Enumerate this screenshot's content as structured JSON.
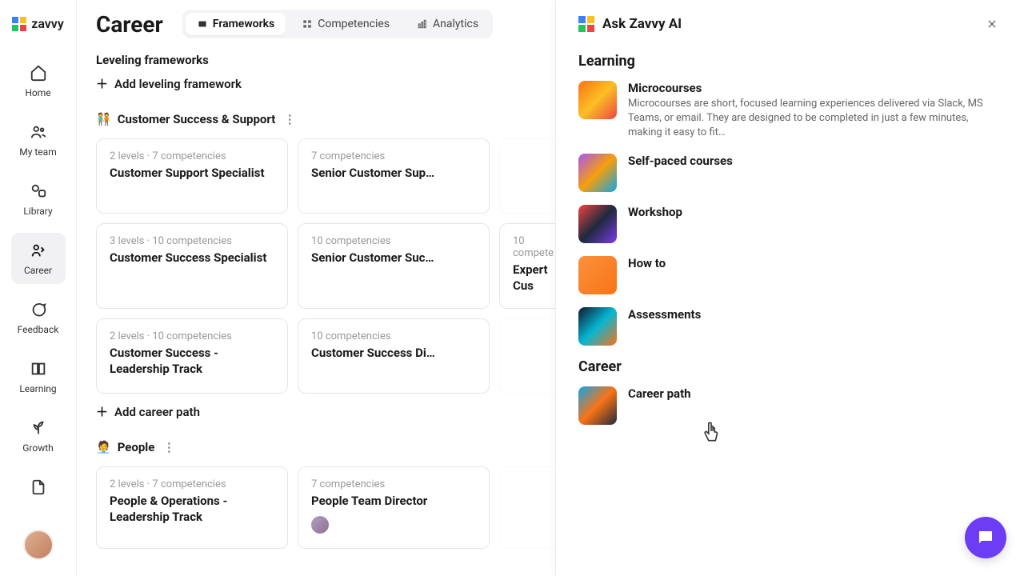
{
  "brand": "zavvy",
  "nav": [
    {
      "label": "Home"
    },
    {
      "label": "My team"
    },
    {
      "label": "Library"
    },
    {
      "label": "Career"
    },
    {
      "label": "Feedback"
    },
    {
      "label": "Learning"
    },
    {
      "label": "Growth"
    }
  ],
  "page_title": "Career",
  "tabs": [
    {
      "label": "Frameworks"
    },
    {
      "label": "Competencies"
    },
    {
      "label": "Analytics"
    }
  ],
  "section_title": "Leveling frameworks",
  "add_framework": "Add leveling framework",
  "add_career_path": "Add career path",
  "groups": [
    {
      "emoji": "🧑‍🤝‍🧑",
      "name": "Customer Success & Support",
      "rows": [
        [
          {
            "meta": "2 levels · 7 competencies",
            "title": "Customer Support Specialist"
          },
          {
            "meta": "7 competencies",
            "title": "Senior Customer Sup…"
          }
        ],
        [
          {
            "meta": "3 levels · 10 competencies",
            "title": "Customer Success Specialist"
          },
          {
            "meta": "10 competencies",
            "title": "Senior Customer Suc…"
          },
          {
            "meta": "10 compete",
            "title": "Expert Cus"
          }
        ],
        [
          {
            "meta": "2 levels · 10 competencies",
            "title": "Customer Success - Leadership Track"
          },
          {
            "meta": "10 competencies",
            "title": "Customer Success Di…"
          }
        ]
      ]
    },
    {
      "emoji": "🧑‍💼",
      "name": "People",
      "rows": [
        [
          {
            "meta": "2 levels · 7 competencies",
            "title": "People & Operations - Leadership Track"
          },
          {
            "meta": "7 competencies",
            "title": "People Team Director",
            "avatar": true
          }
        ]
      ]
    }
  ],
  "panel": {
    "title": "Ask Zavvy AI",
    "sections": [
      {
        "title": "Learning",
        "items": [
          {
            "title": "Microcourses",
            "desc": "Microcourses are short, focused learning experiences delivered via Slack, MS Teams, or email. They are designed to be completed in just a few minutes, making it easy to fit…",
            "thumb": "linear-gradient(135deg,#f97316,#fbbf24,#ef4444)"
          },
          {
            "title": "Self-paced courses",
            "thumb": "linear-gradient(135deg,#a855f7,#f59e0b,#0ea5e9)"
          },
          {
            "title": "Workshop",
            "thumb": "linear-gradient(135deg,#ef4444,#1e293b,#7c3aed)"
          },
          {
            "title": "How to",
            "thumb": "linear-gradient(135deg,#fb923c,#f97316)"
          },
          {
            "title": "Assessments",
            "thumb": "linear-gradient(135deg,#0f172a,#06b6d4,#f97316)"
          }
        ]
      },
      {
        "title": "Career",
        "items": [
          {
            "title": "Career path",
            "thumb": "linear-gradient(135deg,#0ea5e9,#f97316,#1e293b)"
          }
        ]
      }
    ]
  }
}
